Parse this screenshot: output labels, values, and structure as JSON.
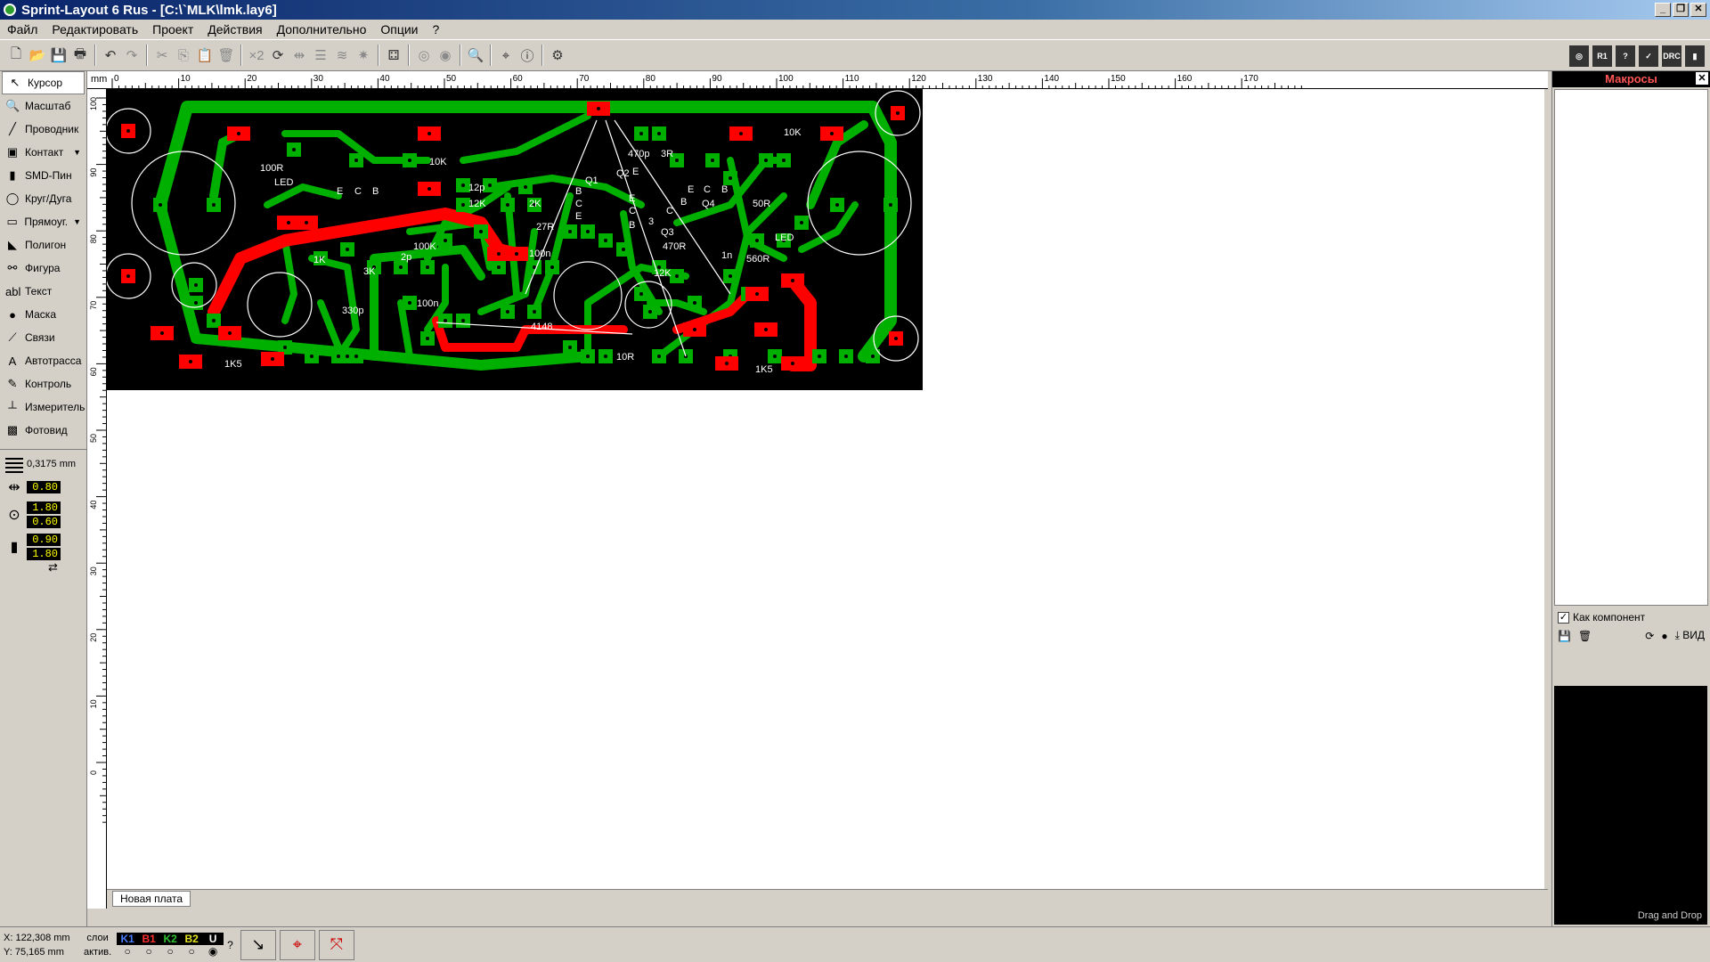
{
  "window": {
    "title": "Sprint-Layout 6 Rus - [C:\\`MLK\\lmk.lay6]"
  },
  "menu": [
    "Файл",
    "Редактировать",
    "Проект",
    "Действия",
    "Дополнительно",
    "Опции",
    "?"
  ],
  "toolbar": {
    "mirror_label": "×2"
  },
  "tools": [
    {
      "label": "Курсор",
      "icon": "cursor-icon",
      "glyph": "↖",
      "active": true
    },
    {
      "label": "Масштаб",
      "icon": "zoom-icon",
      "glyph": "🔍"
    },
    {
      "label": "Проводник",
      "icon": "track-icon",
      "glyph": "╱"
    },
    {
      "label": "Контакт",
      "icon": "pad-icon",
      "glyph": "▣",
      "dropdown": true
    },
    {
      "label": "SMD-Пин",
      "icon": "smd-icon",
      "glyph": "▮"
    },
    {
      "label": "Круг/Дуга",
      "icon": "circle-icon",
      "glyph": "◯"
    },
    {
      "label": "Прямоуг.",
      "icon": "rect-icon",
      "glyph": "▭",
      "dropdown": true
    },
    {
      "label": "Полигон",
      "icon": "polygon-icon",
      "glyph": "◣"
    },
    {
      "label": "Фигура",
      "icon": "shape-icon",
      "glyph": "⚯"
    },
    {
      "label": "Текст",
      "icon": "text-icon",
      "glyph": "abl"
    },
    {
      "label": "Маска",
      "icon": "mask-icon",
      "glyph": "●"
    },
    {
      "label": "Связи",
      "icon": "connections-icon",
      "glyph": "⟋"
    },
    {
      "label": "Автотрасса",
      "icon": "autoroute-icon",
      "glyph": "A"
    },
    {
      "label": "Контроль",
      "icon": "control-icon",
      "glyph": "✎"
    },
    {
      "label": "Измеритель",
      "icon": "measure-icon",
      "glyph": "┴"
    },
    {
      "label": "Фотовид",
      "icon": "photoview-icon",
      "glyph": "▩"
    }
  ],
  "grid": {
    "value": "0,3175 mm"
  },
  "params": {
    "track_width": "0.80",
    "pad_outer": "1.80",
    "pad_inner": "0.60",
    "smd_w": "0.90",
    "smd_h": "1.80"
  },
  "ruler": {
    "unit": "mm",
    "h_ticks": [
      "0",
      "10",
      "20",
      "30",
      "40",
      "50",
      "60",
      "70",
      "80",
      "90",
      "100",
      "110",
      "120",
      "130",
      "140",
      "150",
      "160",
      "170"
    ],
    "v_ticks": [
      "100",
      "90",
      "80",
      "70",
      "60",
      "50",
      "40",
      "30",
      "20",
      "10",
      "0"
    ]
  },
  "board": {
    "labels": [
      "100R",
      "LED",
      "E",
      "C",
      "B",
      "10K",
      "12p",
      "12K",
      "2K",
      "Q1",
      "470p",
      "3R",
      "Q2",
      "E",
      "C",
      "B",
      "Q4",
      "E",
      "C",
      "B",
      "50R",
      "10K",
      "LED",
      "27R",
      "E",
      "C",
      "B",
      "E",
      "C",
      "B",
      "3",
      "Q3",
      "470R",
      "100K",
      "1K",
      "3K",
      "2p",
      "100n",
      "1n",
      "560R",
      "12K",
      "330p",
      "100n",
      "4148",
      "10R",
      "1K5",
      "1K5"
    ],
    "colors": {
      "copper_top": "#00b000",
      "copper_bottom": "#ff0000",
      "background": "#000000",
      "silkscreen": "#ffffff"
    }
  },
  "tab": {
    "name": "Новая плата"
  },
  "macros": {
    "title": "Макросы",
    "as_component": "Как компонент",
    "view_label": "ВИД",
    "drag_drop": "Drag and Drop"
  },
  "status": {
    "x": "X: 122,308 mm",
    "y": "Y: 75,165 mm",
    "layers_label": "слои",
    "active_label": "актив.",
    "layers": [
      {
        "name": "K1",
        "color": "#4a7cff"
      },
      {
        "name": "B1",
        "color": "#ff3030"
      },
      {
        "name": "K2",
        "color": "#30c030"
      },
      {
        "name": "B2",
        "color": "#e0e020"
      },
      {
        "name": "U",
        "color": "#ffffff"
      }
    ],
    "question": "?"
  }
}
